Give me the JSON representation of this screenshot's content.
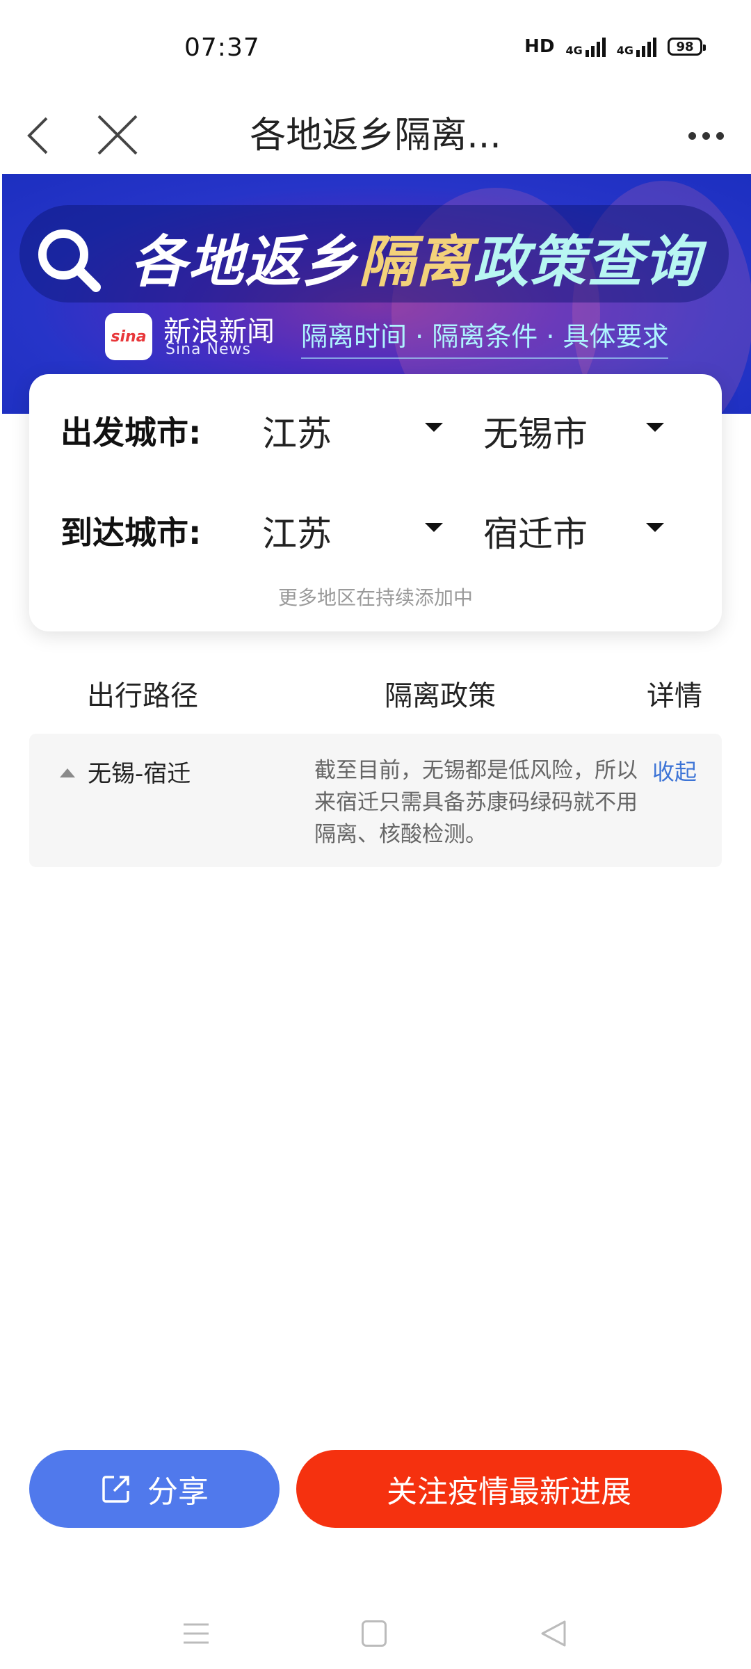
{
  "status_bar": {
    "time": "07:37",
    "network": "HD",
    "signal1": "4G",
    "signal2": "4G",
    "battery": "98"
  },
  "nav": {
    "title": "各地返乡隔离..."
  },
  "banner": {
    "title_part1": "各地返乡",
    "title_part2": "隔离",
    "title_part3": "政策查询",
    "sina_logo": "sina",
    "sina_cn": "新浪新闻",
    "sina_en": "Sina News",
    "subtitle": "隔离时间 · 隔离条件 · 具体要求"
  },
  "form": {
    "departure_label": "出发城市:",
    "departure_province": "江苏",
    "departure_city": "无锡市",
    "arrival_label": "到达城市:",
    "arrival_province": "江苏",
    "arrival_city": "宿迁市",
    "hint": "更多地区在持续添加中"
  },
  "table": {
    "headers": [
      "出行路径",
      "隔离政策",
      "详情"
    ],
    "rows": [
      {
        "route": "无锡-宿迁",
        "policy": "截至目前，无锡都是低风险，所以来宿迁只需具备苏康码绿码就不用隔离、核酸检测。",
        "action": "收起"
      }
    ]
  },
  "buttons": {
    "share": "分享",
    "follow": "关注疫情最新进展"
  },
  "colors": {
    "share_button": "#5079ec",
    "follow_button": "#f5310f",
    "link": "#3d74d6",
    "banner": "#2634c8"
  },
  "icons": [
    "back-icon",
    "close-icon",
    "more-icon",
    "search-icon",
    "share-icon",
    "menu-icon",
    "home-icon",
    "system-back-icon"
  ]
}
